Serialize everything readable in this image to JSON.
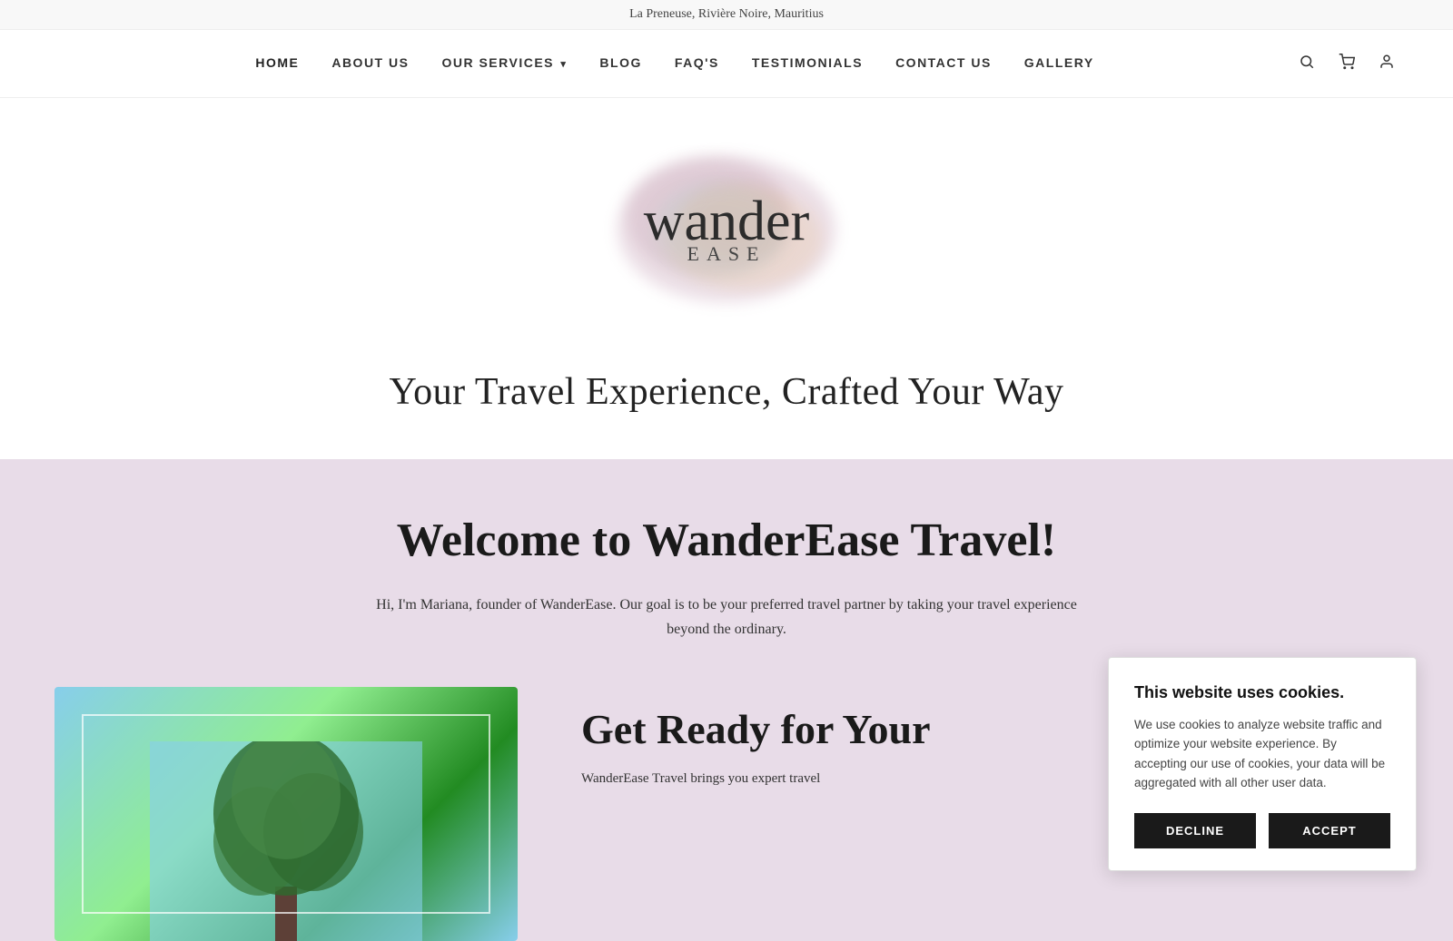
{
  "topbar": {
    "address": "La Preneuse, Rivière Noire, Mauritius"
  },
  "nav": {
    "links": [
      {
        "id": "home",
        "label": "HOME",
        "active": true
      },
      {
        "id": "about",
        "label": "ABOUT US",
        "active": false
      },
      {
        "id": "services",
        "label": "OUR SERVICES",
        "active": false,
        "dropdown": true
      },
      {
        "id": "blog",
        "label": "BLOG",
        "active": false
      },
      {
        "id": "faqs",
        "label": "FAQ'S",
        "active": false
      },
      {
        "id": "testimonials",
        "label": "TESTIMONIALS",
        "active": false
      },
      {
        "id": "contact",
        "label": "CONTACT US",
        "active": false
      },
      {
        "id": "gallery",
        "label": "GALLERY",
        "active": false
      }
    ],
    "icons": {
      "search": "🔍",
      "cart": "🛒",
      "user": "👤"
    }
  },
  "logo": {
    "wander": "wander",
    "ease": "EASE"
  },
  "hero": {
    "tagline": "Your Travel Experience, Crafted Your Way"
  },
  "welcome": {
    "title": "Welcome to WanderEase Travel!",
    "description": "Hi, I'm Mariana,  founder of WanderEase. Our goal is to be your preferred travel partner by taking your travel experience beyond the ordinary.",
    "get_ready_title": "Get Ready for Your",
    "get_ready_desc": "WanderEase Travel brings you expert travel"
  },
  "cookie": {
    "title": "This website uses cookies.",
    "text": "We use cookies to analyze website traffic and optimize your website experience. By accepting our use of cookies, your data will be aggregated with all other user data.",
    "decline_label": "DECLINE",
    "accept_label": "ACCEPT"
  }
}
